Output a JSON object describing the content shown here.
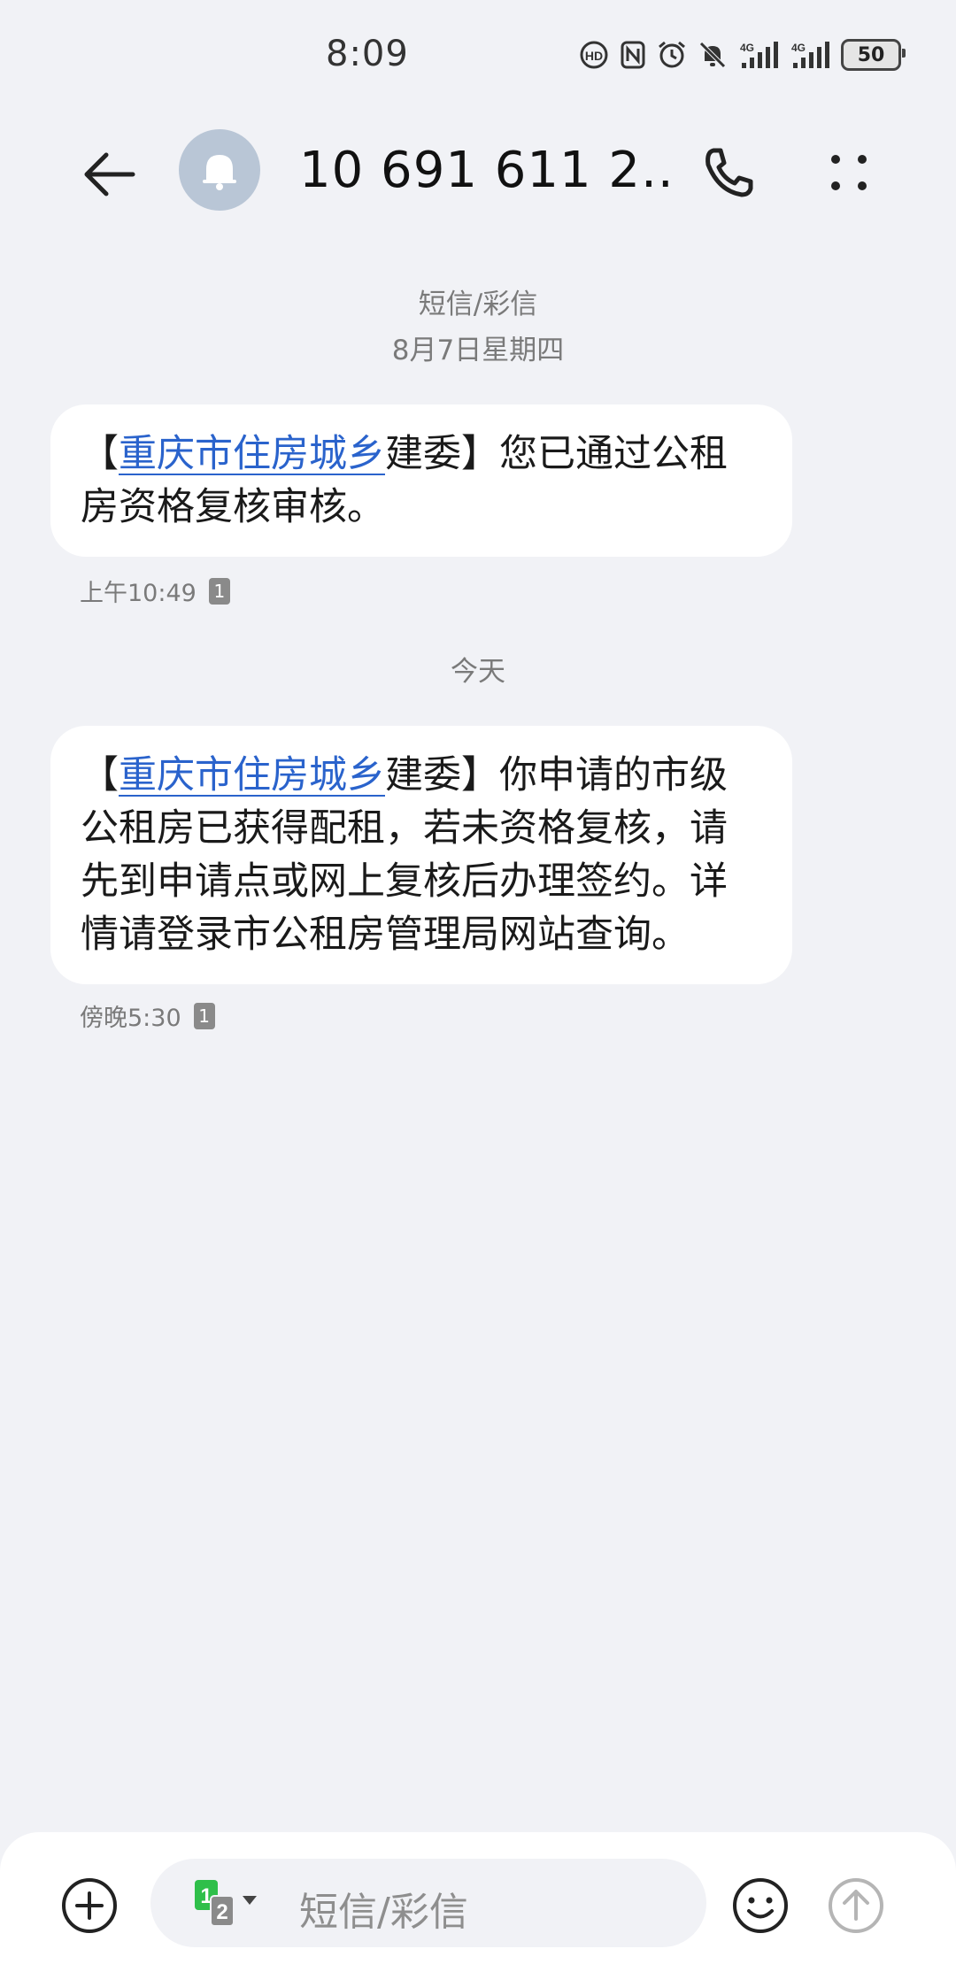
{
  "status_bar": {
    "time": "8:09",
    "battery": "50",
    "icons": [
      "hd-call-icon",
      "nfc-icon",
      "alarm-icon",
      "mute-icon",
      "signal-4g-1-icon",
      "signal-4g-2-icon",
      "battery-icon"
    ]
  },
  "header": {
    "title": "10 691 611 2...",
    "avatar_icon": "bell-icon"
  },
  "conversation": {
    "type_label": "短信/彩信",
    "date_label": "8月7日星期四",
    "today_label": "今天",
    "messages": [
      {
        "bracket_open": "【",
        "link_text": "重庆市住房城乡",
        "text_after": "建委】您已通过公租房资格复核审核。",
        "time": "上午10:49",
        "sim": "1"
      },
      {
        "bracket_open": "【",
        "link_text": "重庆市住房城乡",
        "text_after": "建委】你申请的市级公租房已获得配租，若未资格复核，请先到申请点或网上复核后办理签约。详情请登录市公租房管理局网站查询。",
        "time": "傍晚5:30",
        "sim": "1"
      }
    ]
  },
  "input_bar": {
    "placeholder": "短信/彩信",
    "sim_primary": "1",
    "sim_secondary": "2",
    "accent_green": "#2fbf4a"
  }
}
